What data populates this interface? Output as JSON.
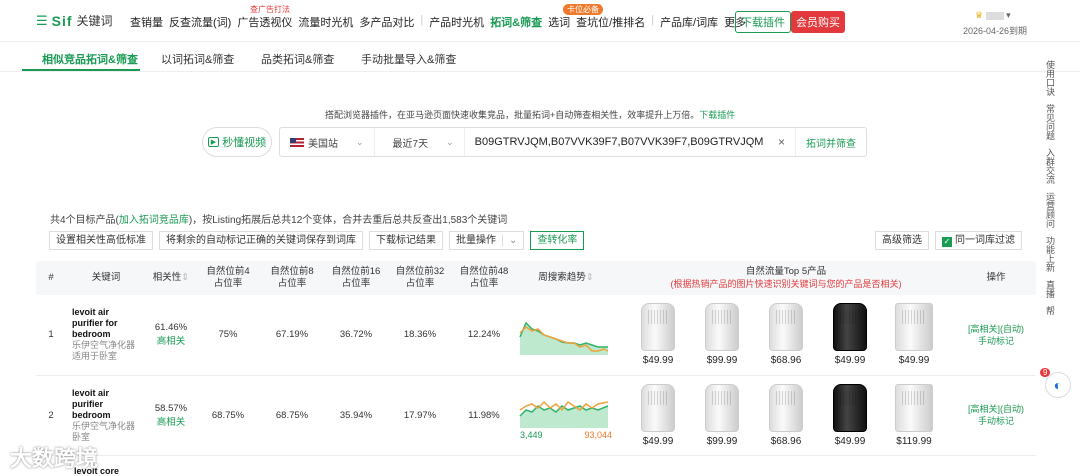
{
  "header": {
    "logo_brand": "Sif",
    "logo_sub": "关键词",
    "nav": [
      "查销量",
      "反查流量(词)",
      "广告透视仪",
      "流量时光机",
      "多产品对比",
      "|",
      "产品时光机",
      "拓词&筛查",
      "选词",
      "查坑位/推排名",
      "|",
      "产品库/词库",
      "更多"
    ],
    "nav_active": "拓词&筛查",
    "tag_ad": "查广告打法",
    "tag_hot": "卡位必备",
    "download_label": "下载插件",
    "vip_label": "会员购买",
    "expire": "2026-04-26到期"
  },
  "tabs": [
    "相似竞品拓词&筛查",
    "以词拓词&筛查",
    "品类拓词&筛查",
    "手动批量导入&筛查"
  ],
  "notice": {
    "text": "搭配浏览器插件，在亚马逊页面快速收集竞品，批量拓词+自动筛查相关性，效率提升上万倍。",
    "link": "下载插件"
  },
  "search": {
    "video_btn": "秒懂视频",
    "site": "美国站",
    "period": "最近7天",
    "asins": "B09GTRVJQM,B07VVK39F7,B07VVK39F7,B09GTRVJQM",
    "clear": "×",
    "submit": "拓词并筛查"
  },
  "summary": {
    "prefix": "共4个目标产品(",
    "link": "加入拓词竞品库",
    "suffix": ")，按Listing拓展后总共12个变体，合并去重后总共反查出1,583个关键词"
  },
  "actions": [
    "设置相关性高低标准",
    "将剩余的自动标记正确的关键词保存到词库",
    "下载标记结果",
    "批量操作",
    "查转化率"
  ],
  "right_actions": [
    "高级筛选",
    "同一词库过滤"
  ],
  "columns": {
    "idx": "#",
    "keyword": "关键词",
    "relevance": "相关性",
    "r4": "自然位前4\n占位率",
    "r8": "自然位前8\n占位率",
    "r16": "自然位前16\n占位率",
    "r32": "自然位前32\n占位率",
    "r48": "自然位前48\n占位率",
    "trend": "周搜索趋势",
    "top5": "自然流量Top 5产品",
    "top5_note": "(根据热销产品的图片快速识别关键词与您的产品是否相关)",
    "op": "操作"
  },
  "rows": [
    {
      "idx": "1",
      "kw": "levoit air purifier for bedroom",
      "cn": "乐伊空气净化器适用于卧室",
      "rel": "61.46%",
      "rel_label": "高相关",
      "r4": "75%",
      "r8": "67.19%",
      "r16": "36.72%",
      "r32": "18.36%",
      "r48": "12.24%",
      "trend_min": "",
      "trend_max": "",
      "prices": [
        "$49.99",
        "$99.99",
        "$68.96",
        "$49.99",
        "$49.99"
      ],
      "op1": "[高相关](自动)",
      "op2": "手动标记"
    },
    {
      "idx": "2",
      "kw": "levoit air purifier bedroom",
      "cn": "乐伊空气净化器卧室",
      "rel": "58.57%",
      "rel_label": "高相关",
      "r4": "68.75%",
      "r8": "68.75%",
      "r16": "35.94%",
      "r32": "17.97%",
      "r48": "11.98%",
      "trend_min": "3,449",
      "trend_max": "93,044",
      "prices": [
        "$49.99",
        "$99.99",
        "$68.96",
        "$49.99",
        "$119.99"
      ],
      "op1": "[高相关](自动)",
      "op2": "手动标记"
    }
  ],
  "row3_kw": "levoit core",
  "sidebar": [
    "使用口诀",
    "常见问题",
    "入群交流",
    "运营顾问",
    "功能上新",
    "直播",
    "帮"
  ],
  "float_badge": "9",
  "watermark": "大数跨境",
  "colors": {
    "accent": "#1a9b54",
    "red": "#e4393c",
    "trend_green": "#2fb36a",
    "trend_orange": "#f0a23a"
  }
}
